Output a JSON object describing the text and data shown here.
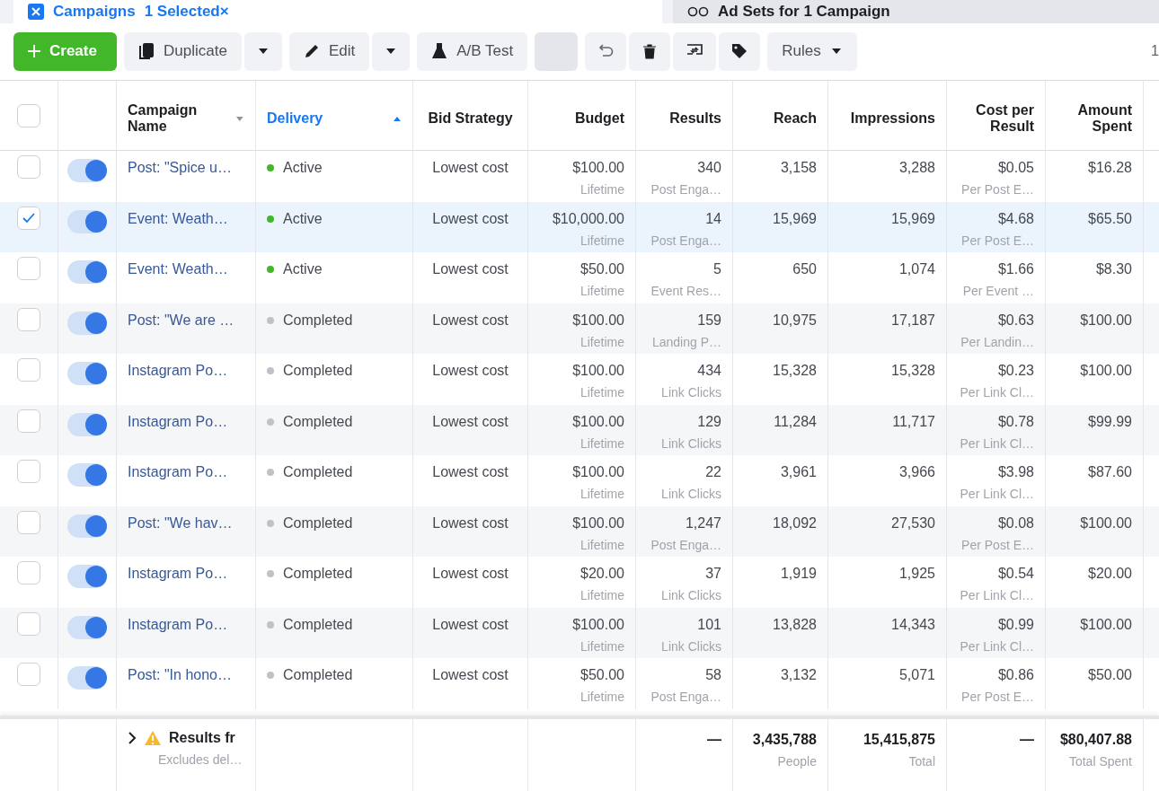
{
  "tabs": [
    {
      "label": "Campaigns",
      "selected": true,
      "badge": "1 Selected",
      "badge_close": "×"
    },
    {
      "label": "Ad Sets for 1 Campaign",
      "selected": false
    }
  ],
  "toolbar": {
    "create": "Create",
    "duplicate": "Duplicate",
    "edit": "Edit",
    "ab_test": "A/B Test",
    "rules": "Rules",
    "page_indicator": "1"
  },
  "table": {
    "select_all": {
      "checked": false
    },
    "columns": [
      {
        "label": "Campaign Name",
        "kind": "sortable",
        "sorted": false
      },
      {
        "label": "Delivery",
        "kind": "sortable",
        "sorted": true
      },
      {
        "label": "Bid Strategy",
        "kind": "plain",
        "sorted": false
      },
      {
        "label": "Budget",
        "kind": "plain",
        "sorted": false
      },
      {
        "label": "Results",
        "kind": "plain",
        "sorted": false
      },
      {
        "label": "Reach",
        "kind": "plain",
        "sorted": false
      },
      {
        "label": "Impressions",
        "kind": "plain",
        "sorted": false
      },
      {
        "label": "Cost per Result",
        "kind": "plain",
        "sorted": false
      },
      {
        "label": "Amount Spent",
        "kind": "plain",
        "sorted": false
      }
    ],
    "rows": [
      {
        "checked": false,
        "on": true,
        "name": "Post: \"Spice u…",
        "delivery": "Active",
        "color": "#42b72a",
        "bid": "Lowest cost",
        "budget": "$100.00",
        "budget_note": "Lifetime",
        "results": "340",
        "results_note": "Post Enga…",
        "reach": "3,158",
        "impressions": "3,288",
        "cost": "$0.05",
        "cost_note": "Per Post E…",
        "spent": "$16.28"
      },
      {
        "checked": true,
        "on": true,
        "name": "Event: Weath…",
        "delivery": "Active",
        "color": "#42b72a",
        "bid": "Lowest cost",
        "budget": "$10,000.00",
        "budget_note": "Lifetime",
        "results": "14",
        "results_note": "Post Enga…",
        "reach": "15,969",
        "impressions": "15,969",
        "cost": "$4.68",
        "cost_note": "Per Post E…",
        "spent": "$65.50"
      },
      {
        "checked": false,
        "on": true,
        "name": "Event: Weath…",
        "delivery": "Active",
        "color": "#42b72a",
        "bid": "Lowest cost",
        "budget": "$50.00",
        "budget_note": "Lifetime",
        "results": "5",
        "results_note": "Event Res…",
        "reach": "650",
        "impressions": "1,074",
        "cost": "$1.66",
        "cost_note": "Per Event …",
        "spent": "$8.30"
      },
      {
        "checked": false,
        "on": true,
        "name": "Post: \"We are …",
        "delivery": "Completed",
        "color": "#bec3c9",
        "bid": "Lowest cost",
        "budget": "$100.00",
        "budget_note": "Lifetime",
        "results": "159",
        "results_note": "Landing P…",
        "reach": "10,975",
        "impressions": "17,187",
        "cost": "$0.63",
        "cost_note": "Per Landin…",
        "spent": "$100.00"
      },
      {
        "checked": false,
        "on": true,
        "name": "Instagram Po…",
        "delivery": "Completed",
        "color": "#bec3c9",
        "bid": "Lowest cost",
        "budget": "$100.00",
        "budget_note": "Lifetime",
        "results": "434",
        "results_note": "Link Clicks",
        "reach": "15,328",
        "impressions": "15,328",
        "cost": "$0.23",
        "cost_note": "Per Link Cl…",
        "spent": "$100.00"
      },
      {
        "checked": false,
        "on": true,
        "name": "Instagram Po…",
        "delivery": "Completed",
        "color": "#bec3c9",
        "bid": "Lowest cost",
        "budget": "$100.00",
        "budget_note": "Lifetime",
        "results": "129",
        "results_note": "Link Clicks",
        "reach": "11,284",
        "impressions": "11,717",
        "cost": "$0.78",
        "cost_note": "Per Link Cl…",
        "spent": "$99.99"
      },
      {
        "checked": false,
        "on": true,
        "name": "Instagram Po…",
        "delivery": "Completed",
        "color": "#bec3c9",
        "bid": "Lowest cost",
        "budget": "$100.00",
        "budget_note": "Lifetime",
        "results": "22",
        "results_note": "Link Clicks",
        "reach": "3,961",
        "impressions": "3,966",
        "cost": "$3.98",
        "cost_note": "Per Link Cl…",
        "spent": "$87.60"
      },
      {
        "checked": false,
        "on": true,
        "name": "Post: \"We hav…",
        "delivery": "Completed",
        "color": "#bec3c9",
        "bid": "Lowest cost",
        "budget": "$100.00",
        "budget_note": "Lifetime",
        "results": "1,247",
        "results_note": "Post Enga…",
        "reach": "18,092",
        "impressions": "27,530",
        "cost": "$0.08",
        "cost_note": "Per Post E…",
        "spent": "$100.00"
      },
      {
        "checked": false,
        "on": true,
        "name": "Instagram Po…",
        "delivery": "Completed",
        "color": "#bec3c9",
        "bid": "Lowest cost",
        "budget": "$20.00",
        "budget_note": "Lifetime",
        "results": "37",
        "results_note": "Link Clicks",
        "reach": "1,919",
        "impressions": "1,925",
        "cost": "$0.54",
        "cost_note": "Per Link Cl…",
        "spent": "$20.00"
      },
      {
        "checked": false,
        "on": true,
        "name": "Instagram Po…",
        "delivery": "Completed",
        "color": "#bec3c9",
        "bid": "Lowest cost",
        "budget": "$100.00",
        "budget_note": "Lifetime",
        "results": "101",
        "results_note": "Link Clicks",
        "reach": "13,828",
        "impressions": "14,343",
        "cost": "$0.99",
        "cost_note": "Per Link Cl…",
        "spent": "$100.00"
      },
      {
        "checked": false,
        "on": true,
        "name": "Post: \"In hono…",
        "delivery": "Completed",
        "color": "#bec3c9",
        "bid": "Lowest cost",
        "budget": "$50.00",
        "budget_note": "Lifetime",
        "results": "58",
        "results_note": "Post Enga…",
        "reach": "3,132",
        "impressions": "5,071",
        "cost": "$0.86",
        "cost_note": "Per Post E…",
        "spent": "$50.00"
      }
    ],
    "totals": {
      "label": "Results fr",
      "note": "Excludes del…",
      "results": "—",
      "reach": "3,435,788",
      "reach_note": "People",
      "impressions": "15,415,875",
      "impressions_note": "Total",
      "cost": "—",
      "spent": "$80,407.88",
      "spent_note": "Total Spent"
    }
  }
}
